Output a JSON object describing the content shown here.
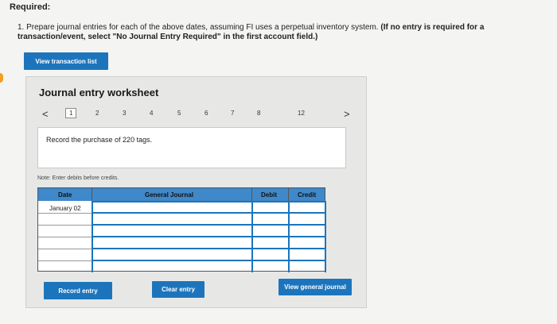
{
  "header": {
    "required_label": "Required:"
  },
  "instruction": {
    "main": "1. Prepare journal entries for each of the above dates, assuming FI uses a perpetual inventory system.",
    "note": "(If no entry is required for a transaction/event, select \"No Journal Entry Required\" in the first account field.)"
  },
  "buttons": {
    "view_transactions": "View transaction list",
    "record_entry": "Record entry",
    "clear_entry": "Clear entry",
    "view_general_journal": "View general journal"
  },
  "worksheet": {
    "title": "Journal entry worksheet",
    "pages": [
      "1",
      "2",
      "3",
      "4",
      "5",
      "6",
      "7",
      "8",
      "12"
    ],
    "active_page": "1",
    "prev_arrow": "<",
    "next_arrow": ">",
    "description": "Record the purchase of 220 tags.",
    "note": "Note: Enter debits before credits.",
    "table": {
      "headers": {
        "date": "Date",
        "account": "General Journal",
        "debit": "Debit",
        "credit": "Credit"
      },
      "first_row_date": "January 02"
    }
  },
  "colors": {
    "accent": "#1c75bc",
    "header_bg": "#3f88c9"
  }
}
